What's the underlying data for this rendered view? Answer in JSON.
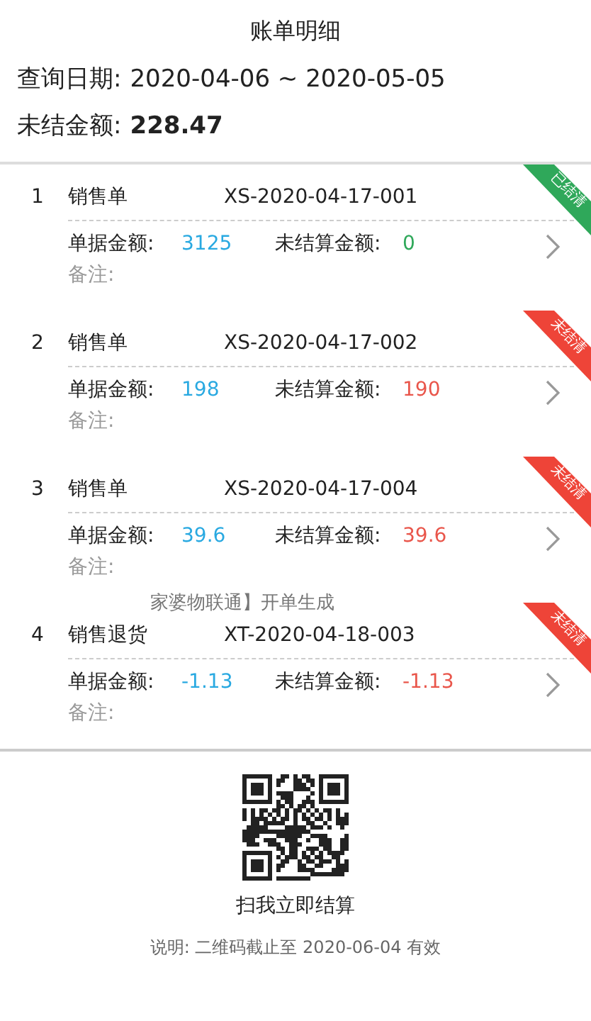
{
  "header": {
    "title": "账单明细",
    "query_label": "查询日期:",
    "query_value": "2020-04-06 ~ 2020-05-05",
    "unsettled_label": "未结金额:",
    "unsettled_value": "228.47"
  },
  "bills": [
    {
      "index": "1",
      "type": "销售单",
      "code": "XS-2020-04-17-001",
      "amount_label": "单据金额:",
      "amount": "3125",
      "unsettled_label": "未结算金额:",
      "unsettled": "0",
      "remark": "备注:",
      "settled": true,
      "status": "已结清"
    },
    {
      "index": "2",
      "type": "销售单",
      "code": "XS-2020-04-17-002",
      "amount_label": "单据金额:",
      "amount": "198",
      "unsettled_label": "未结算金额:",
      "unsettled": "190",
      "remark": "备注:",
      "settled": false,
      "status": "未结清"
    },
    {
      "index": "3",
      "type": "销售单",
      "code": "XS-2020-04-17-004",
      "amount_label": "单据金额:",
      "amount": "39.6",
      "unsettled_label": "未结算金额:",
      "unsettled": "39.6",
      "remark": "备注:",
      "settled": false,
      "status": "未结清"
    },
    {
      "index": "4",
      "type": "销售退货",
      "code": "XT-2020-04-18-003",
      "amount_label": "单据金额:",
      "amount": "-1.13",
      "unsettled_label": "未结算金额:",
      "unsettled": "-1.13",
      "remark": "备注:",
      "settled": false,
      "status": "未结清"
    }
  ],
  "toast": "家婆物联通】开单生成",
  "footer": {
    "scan_text": "扫我立即结算",
    "note": "说明: 二维码截止至 2020-06-04 有效"
  }
}
